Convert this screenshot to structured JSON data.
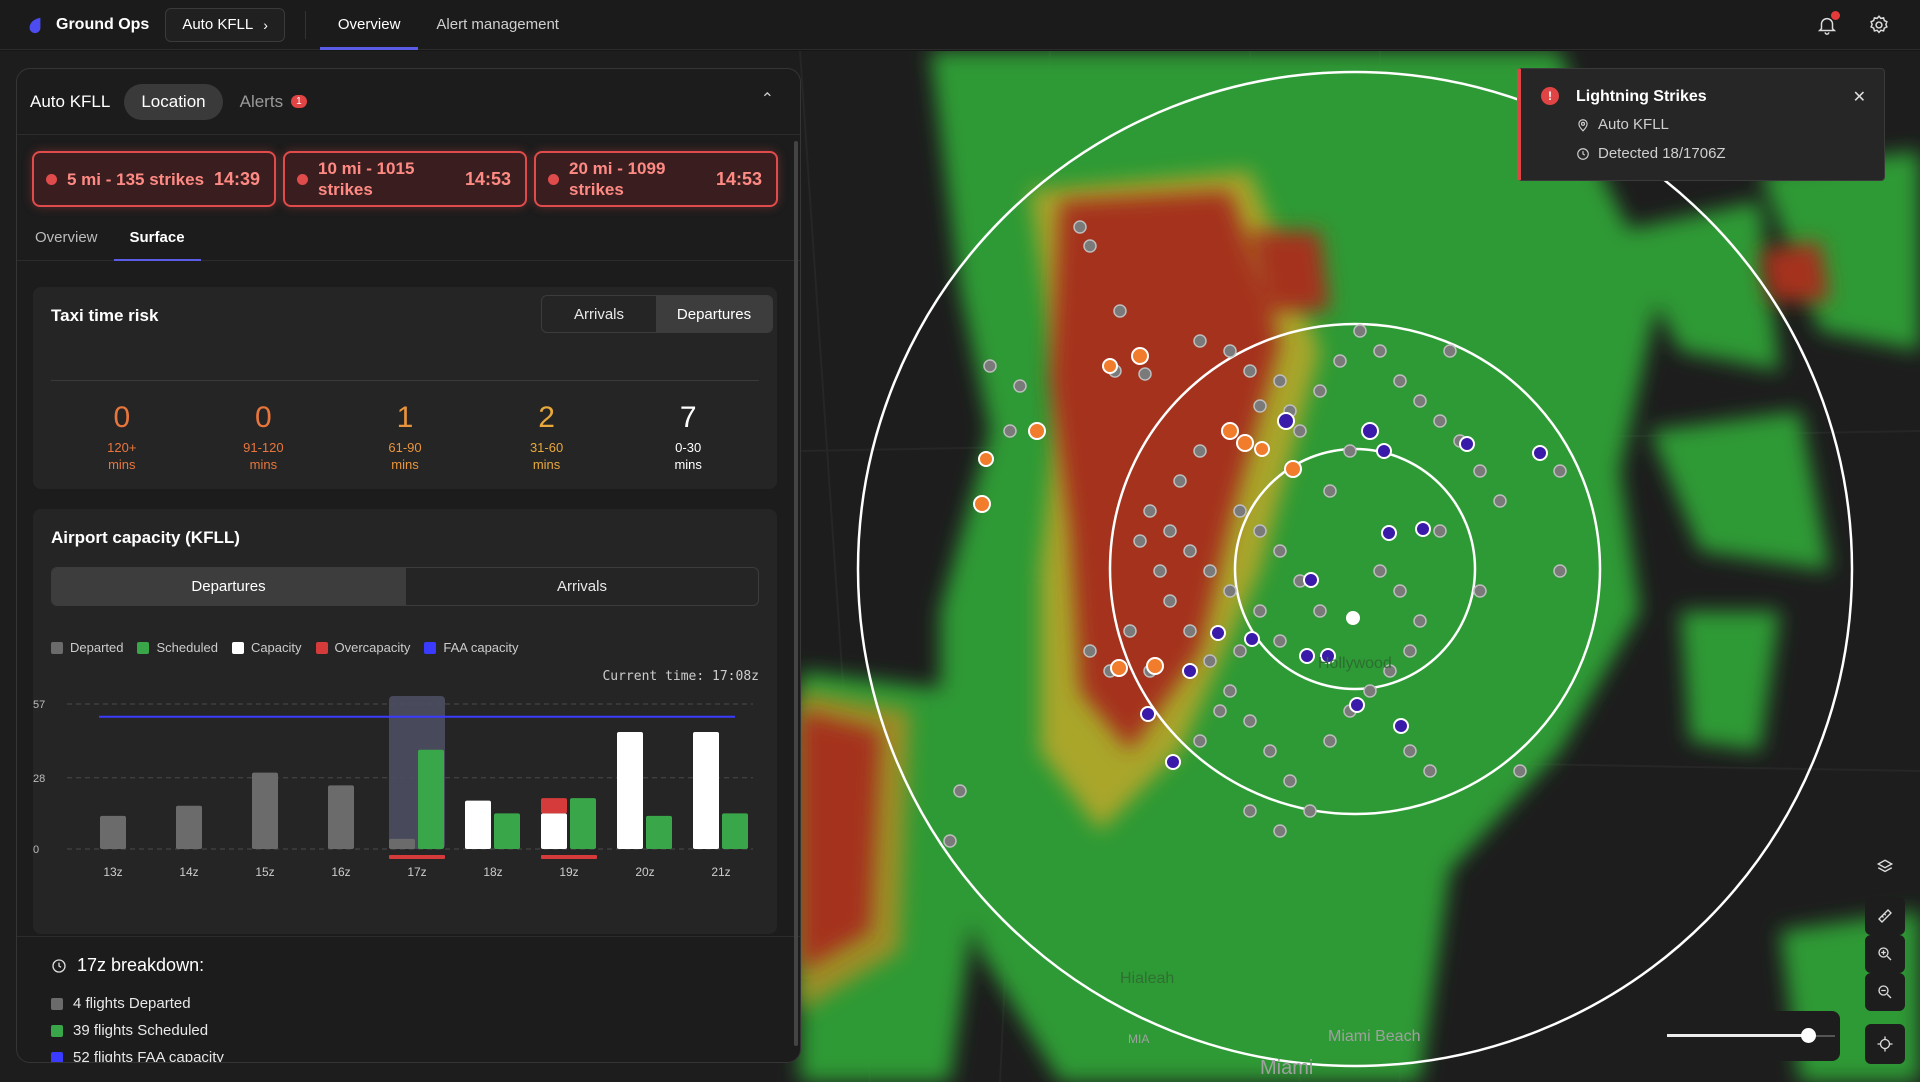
{
  "app": {
    "name": "Ground Ops",
    "location_button": "Auto KFLL"
  },
  "nav": {
    "tabs": [
      {
        "label": "Overview",
        "active": true
      },
      {
        "label": "Alert management",
        "active": false
      }
    ]
  },
  "panel": {
    "title": "Auto KFLL",
    "tabs": [
      {
        "label": "Location",
        "active": true
      },
      {
        "label": "Alerts",
        "active": false
      }
    ],
    "alerts_count": "1",
    "strikes": [
      {
        "label": "5 mi - 135 strikes",
        "time": "14:39"
      },
      {
        "label": "10 mi - 1015 strikes",
        "time": "14:53"
      },
      {
        "label": "20 mi - 1099 strikes",
        "time": "14:53"
      }
    ],
    "subtabs": [
      {
        "label": "Overview",
        "active": false
      },
      {
        "label": "Surface",
        "active": true
      }
    ]
  },
  "taxi": {
    "title": "Taxi time risk",
    "toggle": [
      {
        "label": "Arrivals",
        "active": false
      },
      {
        "label": "Departures",
        "active": true
      }
    ],
    "buckets": [
      {
        "count": "0",
        "range": "120+",
        "unit": "mins",
        "color": "#e8763c"
      },
      {
        "count": "0",
        "range": "91-120",
        "unit": "mins",
        "color": "#e8763c"
      },
      {
        "count": "1",
        "range": "61-90",
        "unit": "mins",
        "color": "#e8943c"
      },
      {
        "count": "2",
        "range": "31-60",
        "unit": "mins",
        "color": "#e8a83c"
      },
      {
        "count": "7",
        "range": "0-30",
        "unit": "mins",
        "color": "#ffffff"
      }
    ]
  },
  "capacity": {
    "title": "Airport capacity (KFLL)",
    "toggle": [
      {
        "label": "Departures",
        "active": true
      },
      {
        "label": "Arrivals",
        "active": false
      }
    ],
    "legend": [
      {
        "label": "Departed",
        "color": "#6b6b6b"
      },
      {
        "label": "Scheduled",
        "color": "#3aa64a"
      },
      {
        "label": "Capacity",
        "color": "#ffffff"
      },
      {
        "label": "Overcapacity",
        "color": "#d63b3b"
      },
      {
        "label": "FAA capacity",
        "color": "#3b3bff"
      }
    ],
    "current_time": "Current time: 17:08z"
  },
  "chart_data": {
    "type": "bar",
    "categories": [
      "13z",
      "14z",
      "15z",
      "16z",
      "17z",
      "18z",
      "19z",
      "20z",
      "21z"
    ],
    "yticks": [
      "0",
      "28",
      "57"
    ],
    "ylim": [
      0,
      57
    ],
    "faa_capacity": 52,
    "highlight": "17z",
    "overcapacity_marks": [
      "17z",
      "19z"
    ],
    "series": [
      {
        "name": "Departed",
        "values": [
          13,
          17,
          30,
          25,
          4,
          0,
          0,
          0,
          0
        ]
      },
      {
        "name": "Scheduled",
        "values": [
          0,
          0,
          0,
          0,
          39,
          14,
          20,
          13,
          14
        ]
      },
      {
        "name": "Capacity",
        "values": [
          0,
          0,
          0,
          0,
          0,
          19,
          14,
          46,
          46
        ]
      },
      {
        "name": "Overcapacity",
        "values": [
          0,
          0,
          0,
          0,
          0,
          0,
          6,
          0,
          0
        ]
      }
    ]
  },
  "breakdown": {
    "title": "17z breakdown:",
    "items": [
      {
        "label": "4 flights Departed",
        "color": "#6b6b6b"
      },
      {
        "label": "39 flights Scheduled",
        "color": "#3aa64a"
      },
      {
        "label": "52 flights FAA capacity",
        "color": "#3b3bff"
      }
    ]
  },
  "toast": {
    "title": "Lightning Strikes",
    "location": "Auto KFLL",
    "detected": "Detected 18/1706Z"
  },
  "map_labels": [
    "Miami Beach",
    "Miami",
    "MIA",
    "Hialeah",
    "Hollywood"
  ]
}
